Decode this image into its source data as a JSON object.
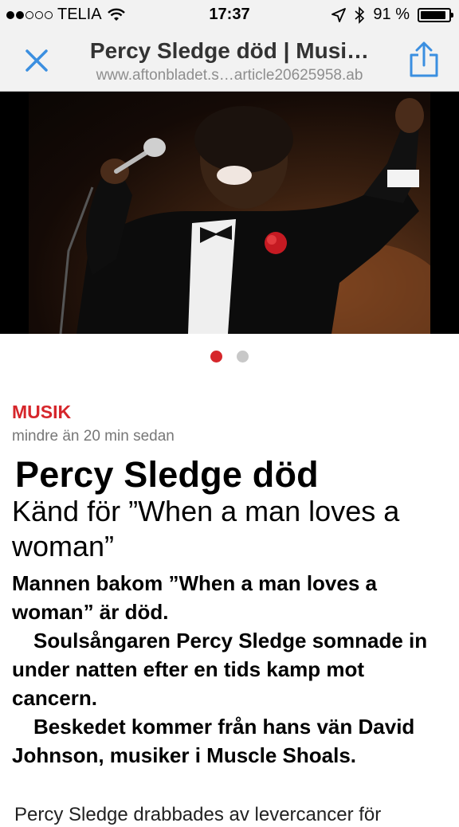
{
  "status_bar": {
    "carrier": "TELIA",
    "time": "17:37",
    "battery_percent": "91 %",
    "battery_level": 0.91,
    "signal_bars_filled": 2,
    "signal_bars_total": 5,
    "icons": [
      "wifi-icon",
      "location-icon",
      "bluetooth-icon",
      "battery-icon"
    ]
  },
  "nav": {
    "title": "Percy Sledge död | Musi…",
    "url": "www.aftonbladet.s…article20625958.ab",
    "accent_color": "#3b8fe0"
  },
  "carousel": {
    "total": 2,
    "active_index": 0,
    "active_color": "#d6262b"
  },
  "article": {
    "category": "MUSIK",
    "timestamp": "mindre än 20 min sedan",
    "headline": "Percy Sledge död",
    "subheadline": "Känd för ”When a man loves a woman”",
    "paragraphs": [
      "Mannen bakom ”When a man loves a woman” är död.",
      "Soulsångaren Percy Sledge somnade in under natten efter en tids kamp mot cancern.",
      "Beskedet kommer från hans vän David Johnson, musiker i Muscle Shoals."
    ],
    "next_line": "Percy Sledge drabbades av levercancer för"
  }
}
